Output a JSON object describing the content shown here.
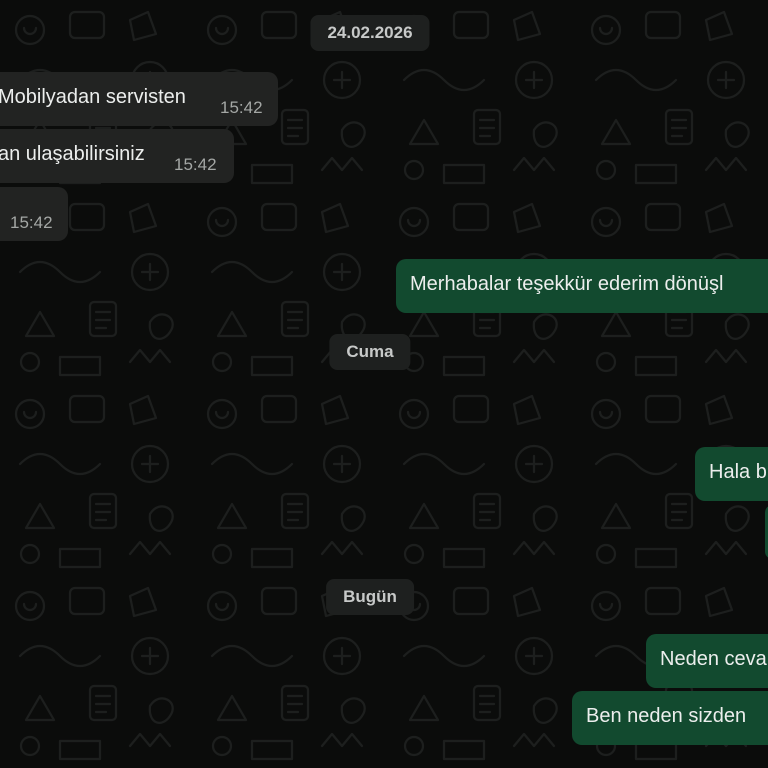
{
  "date_separators": {
    "date_1": "24.02.2026",
    "date_2": "Cuma",
    "date_3": "Bugün"
  },
  "messages": [
    {
      "direction": "incoming",
      "text": "Mobilyadan servisten",
      "time": "15:42"
    },
    {
      "direction": "incoming",
      "text": "an ulaşabilirsiniz",
      "time": "15:42"
    },
    {
      "direction": "incoming",
      "text": "",
      "time": "15:42"
    },
    {
      "direction": "outgoing",
      "text": "Merhabalar teşekkür ederim dönüşl",
      "time": ""
    },
    {
      "direction": "outgoing",
      "text": "Hala b",
      "time": ""
    },
    {
      "direction": "outgoing",
      "text": "",
      "time": ""
    },
    {
      "direction": "outgoing",
      "text": "Neden ceva",
      "time": ""
    },
    {
      "direction": "outgoing",
      "text": "Ben neden sizden",
      "time": ""
    }
  ],
  "colors": {
    "background": "#0b0c0b",
    "incoming_bubble": "#222322",
    "outgoing_bubble": "#124a2f",
    "date_chip": "#1e201f"
  }
}
